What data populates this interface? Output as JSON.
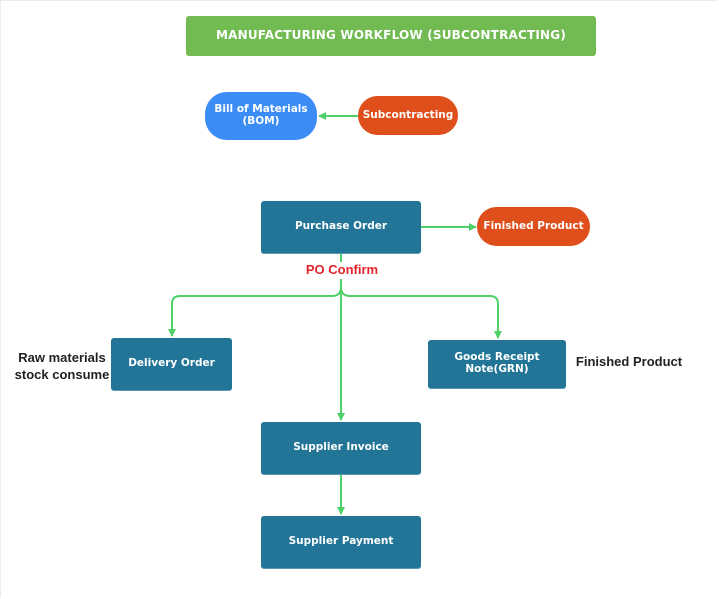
{
  "diagram": {
    "title": "MANUFACTURING WORKFLOW (SUBCONTRACTING)",
    "nodes": {
      "bom": "Bill of Materials\n(BOM)",
      "subcontracting": "Subcontracting",
      "purchase_order": "Purchase Order",
      "finished_product": "Finished Product",
      "delivery_order": "Delivery Order",
      "goods_receipt_note": "Goods Receipt\nNote(GRN)",
      "supplier_invoice": "Supplier Invoice",
      "supplier_payment": "Supplier Payment"
    },
    "labels": {
      "po_confirm": "PO Confirm",
      "raw_materials": "Raw materials stock consume",
      "finished_product_note": "Finished Product"
    },
    "edges": [
      {
        "from": "Subcontracting",
        "to": "Bill of Materials (BOM)"
      },
      {
        "from": "Purchase Order",
        "to": "Finished Product"
      },
      {
        "from": "Purchase Order",
        "to": "Delivery Order",
        "label": "PO Confirm"
      },
      {
        "from": "Purchase Order",
        "to": "Supplier Invoice",
        "label": "PO Confirm"
      },
      {
        "from": "Purchase Order",
        "to": "Goods Receipt Note(GRN)",
        "label": "PO Confirm"
      },
      {
        "from": "Supplier Invoice",
        "to": "Supplier Payment"
      }
    ],
    "colors": {
      "title_bg": "#72bb53",
      "bom": "#3b8cf5",
      "orange": "#df4f1b",
      "process_box": "#227596",
      "arrow": "#4fd16a",
      "po_confirm_text": "#e3232b"
    }
  }
}
